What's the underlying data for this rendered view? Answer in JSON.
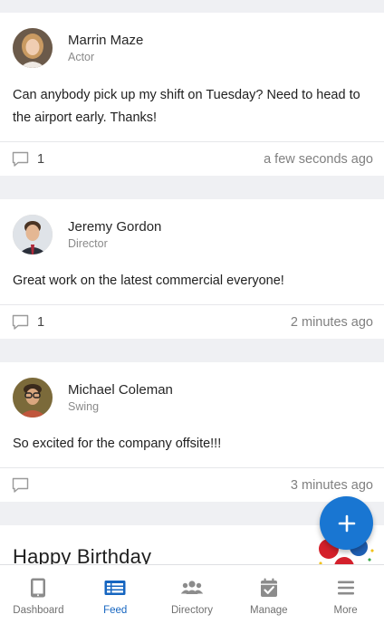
{
  "posts": [
    {
      "author": "Marrin Maze",
      "role": "Actor",
      "text": "Can anybody pick up my shift on Tuesday? Need to head to the airport early. Thanks!",
      "comment_count": "1",
      "timestamp": "a few seconds ago"
    },
    {
      "author": "Jeremy Gordon",
      "role": "Director",
      "text": "Great work on the latest commercial everyone!",
      "comment_count": "1",
      "timestamp": "2 minutes ago"
    },
    {
      "author": "Michael Coleman",
      "role": "Swing",
      "text": "So excited for the company offsite!!!",
      "comment_count": "",
      "timestamp": "3 minutes ago"
    }
  ],
  "birthday_card": {
    "title": "Happy Birthday"
  },
  "fab": {
    "icon": "plus-icon",
    "label": "+"
  },
  "tabs": [
    {
      "label": "Dashboard",
      "icon": "tablet-icon",
      "active": false
    },
    {
      "label": "Feed",
      "icon": "feed-list-icon",
      "active": true
    },
    {
      "label": "Directory",
      "icon": "people-icon",
      "active": false
    },
    {
      "label": "Manage",
      "icon": "calendar-check-icon",
      "active": false
    },
    {
      "label": "More",
      "icon": "menu-icon",
      "active": false
    }
  ],
  "colors": {
    "accent": "#1976d2",
    "active_tab": "#1565c0",
    "page_bg": "#eff0f3"
  }
}
